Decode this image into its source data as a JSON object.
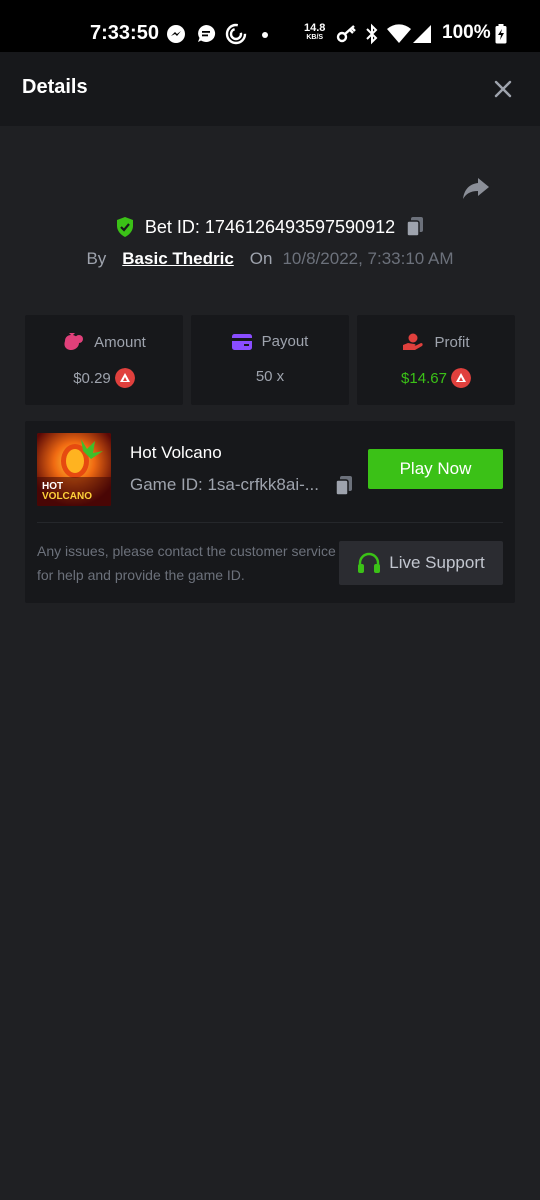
{
  "status_bar": {
    "time": "7:33:50",
    "net_speed_value": "14.8",
    "net_speed_unit": "KB/S",
    "battery": "100%",
    "icons": [
      "messenger-icon",
      "chat-bubble-icon",
      "sync-ring-icon",
      "dot-icon",
      "key-icon",
      "bluetooth-icon",
      "wifi-icon",
      "signal-icon",
      "battery-charging-icon"
    ]
  },
  "header": {
    "title": "Details",
    "close_icon": "close-icon"
  },
  "bet": {
    "id_label": "Bet ID: 1746126493597590912",
    "by_label": "By",
    "username": "Basic Thedric",
    "on_label": "On",
    "date": "10/8/2022, 7:33:10 AM",
    "verified_icon": "shield-check-icon",
    "copy_icon": "copy-icon",
    "share_icon": "share-icon"
  },
  "stats": {
    "amount": {
      "label": "Amount",
      "value": "$0.29",
      "icon": "money-bag-icon",
      "coin_icon": "avax-coin-icon"
    },
    "payout": {
      "label": "Payout",
      "value": "50 x",
      "icon": "card-icon"
    },
    "profit": {
      "label": "Profit",
      "value": "$14.67",
      "icon": "hand-coin-icon",
      "coin_icon": "avax-coin-icon"
    }
  },
  "game": {
    "name": "Hot Volcano",
    "thumb_text_line1": "HOT",
    "thumb_text_line2": "VOLCANO",
    "id_text": "Game ID: 1sa-crfkk8ai-...",
    "play_label": "Play Now",
    "help_text": "Any issues, please contact the customer service for help and provide the game ID.",
    "support_label": "Live Support",
    "support_icon": "headset-icon"
  },
  "colors": {
    "background": "#1f2023",
    "card": "#17181b",
    "accent_green": "#3bc117",
    "coin_red": "#e0403d",
    "amount_pink": "#e0407a",
    "payout_purple": "#8a4dff",
    "profit_red": "#e0403d"
  }
}
